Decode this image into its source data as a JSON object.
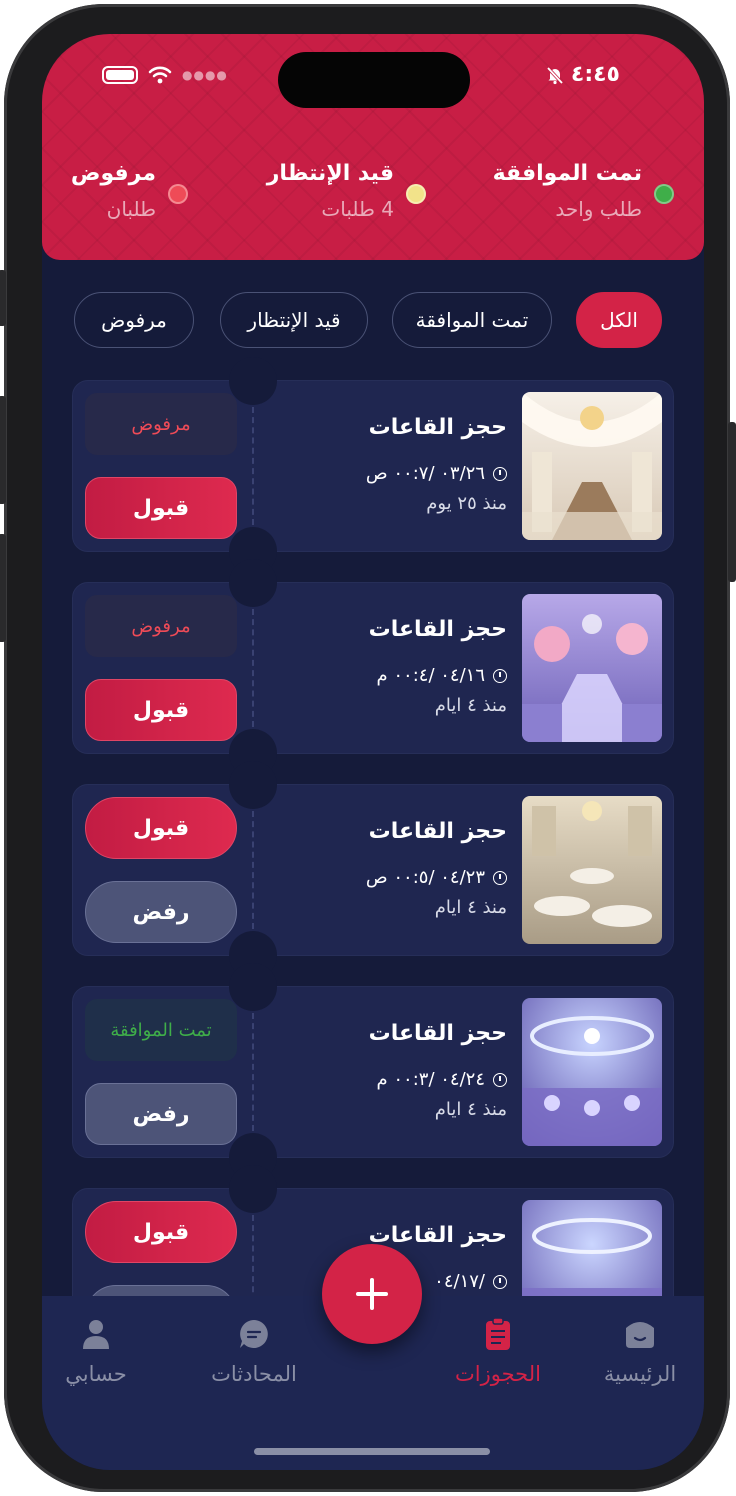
{
  "status_bar": {
    "time": "٤:٤٥"
  },
  "summary": [
    {
      "title": "تمت الموافقة",
      "subtitle": "طلب واحد",
      "color": "#3fae49"
    },
    {
      "title": "قيد الإنتظار",
      "subtitle": "4 طلبات",
      "color": "#f2e38a"
    },
    {
      "title": "مرفوض",
      "subtitle": "طلبان",
      "color": "#ef4b57"
    }
  ],
  "filters": {
    "all": "الكل",
    "approved": "تمت الموافقة",
    "pending": "قيد الإنتظار",
    "rejected": "مرفوض"
  },
  "bookings": [
    {
      "title": "حجز القاعات",
      "date": "٠٣/٢٦ /٠٠:٧ ص",
      "ago": "منذ ٢٥ يوم",
      "status": "مرفوض",
      "action": "قبول"
    },
    {
      "title": "حجز القاعات",
      "date": "٠٤/١٦ /٠٠:٤ م",
      "ago": "منذ ٤ ايام",
      "status": "مرفوض",
      "action": "قبول"
    },
    {
      "title": "حجز القاعات",
      "date": "٠٤/٢٣ /٠٠:٥ ص",
      "ago": "منذ ٤ ايام",
      "accept": "قبول",
      "reject": "رفض"
    },
    {
      "title": "حجز القاعات",
      "date": "٠٤/٢٤ /٠٠:٣ م",
      "ago": "منذ ٤ ايام",
      "status": "تمت الموافقة",
      "reject": "رفض"
    },
    {
      "title": "حجز القاعات",
      "date": "٠٤/١٧/",
      "accept": "قبول"
    }
  ],
  "nav": {
    "home": "الرئيسية",
    "bookings": "الحجوزات",
    "chats": "المحادثات",
    "account": "حسابي"
  },
  "colors": {
    "accent": "#d32347",
    "background": "#151b3a",
    "card": "#1f2650",
    "approved": "#3fae49",
    "rejected": "#ef4b57"
  }
}
